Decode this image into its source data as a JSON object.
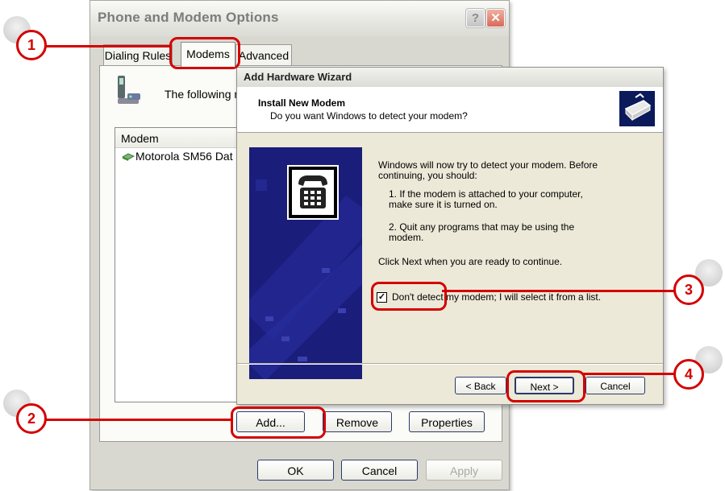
{
  "phone_modem": {
    "title": "Phone and Modem Options",
    "tabs": [
      "Dialing Rules",
      "Modems",
      "Advanced"
    ],
    "intro_text": "The following m",
    "list_header": "Modem",
    "list_items": [
      "Motorola SM56 Dat"
    ],
    "buttons": {
      "add": "Add...",
      "remove": "Remove",
      "properties": "Properties",
      "ok": "OK",
      "cancel": "Cancel",
      "apply": "Apply"
    }
  },
  "wizard": {
    "title": "Add Hardware Wizard",
    "header_title": "Install New Modem",
    "header_subtitle": "Do you want Windows to detect your modem?",
    "intro": "Windows will now try to detect your modem.  Before continuing, you should:",
    "step1": "1.  If the modem is attached to your computer, make sure it is turned on.",
    "step2": "2.  Quit any programs that may be using the modem.",
    "continue_text": "Click Next when you are ready to continue.",
    "checkbox_label": "Don't detect my modem; I will select it from a list.",
    "checkbox_checked": true,
    "checkbox_mark": "✓",
    "buttons": {
      "back": "< Back",
      "next": "Next >",
      "cancel": "Cancel"
    }
  },
  "callouts": [
    "1",
    "2",
    "3",
    "4"
  ],
  "colors": {
    "callout": "#d40000",
    "wizard_side": "#1a1d7a"
  }
}
